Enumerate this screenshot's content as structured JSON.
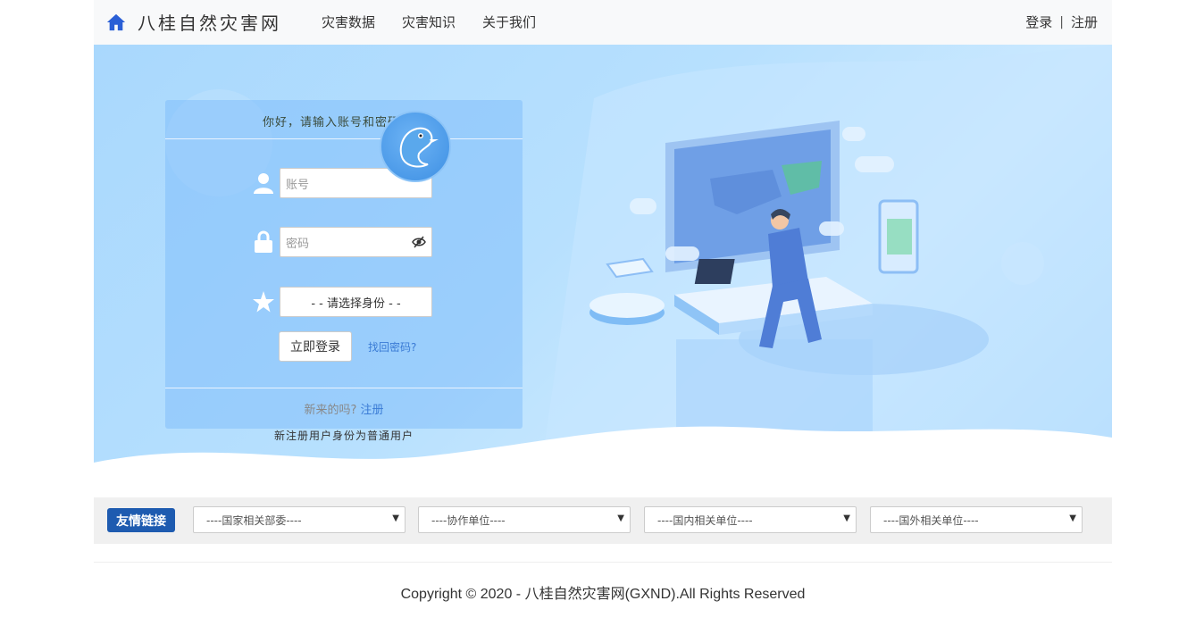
{
  "header": {
    "brand": "八桂自然灾害网",
    "nav": [
      "灾害数据",
      "灾害知识",
      "关于我们"
    ],
    "login": "登录",
    "separator": "|",
    "register": "注册"
  },
  "login_card": {
    "greeting": "你好，请输入账号和密码登录",
    "account_placeholder": "账号",
    "password_placeholder": "密码",
    "role_select": "- - 请选择身份 - -",
    "login_button": "立即登录",
    "forgot_link": "找回密码?",
    "new_here": "新来的吗?",
    "register_link": "注册",
    "note": "新注册用户身份为普通用户"
  },
  "links": {
    "badge": "友情链接",
    "selects": [
      "----国家相关部委----",
      "----协作单位----",
      "----国内相关单位----",
      "----国外相关单位----"
    ]
  },
  "footer": {
    "copyright": "Copyright © 2020 - 八桂自然灾害网(GXND).All Rights Reserved"
  },
  "colors": {
    "accent": "#3a7bd5",
    "badge": "#1e5bb0",
    "header_bg": "#f8f9fa",
    "hero_bg": "#b7e0fe"
  }
}
